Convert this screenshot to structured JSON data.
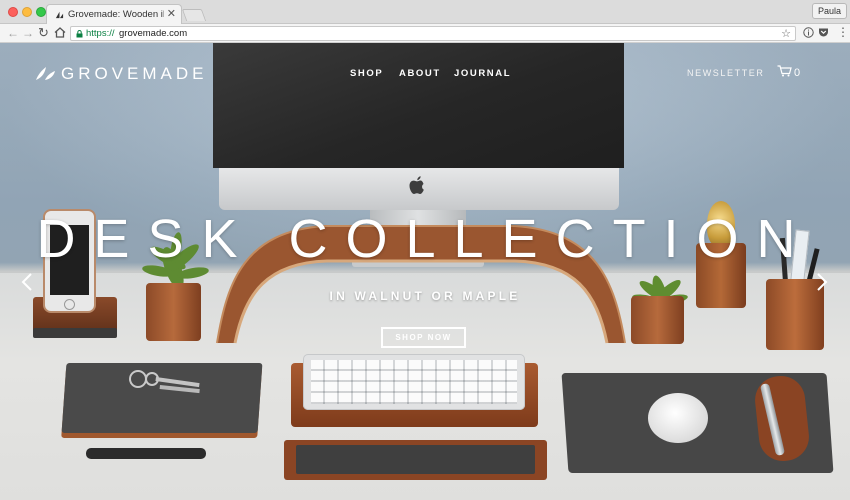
{
  "browser": {
    "tab": {
      "title": "Grovemade: Wooden iPhone C",
      "close": "✕"
    },
    "profile": "Paula",
    "url": {
      "scheme": "https://",
      "host": "grovemade.com"
    },
    "icons": {
      "back": "←",
      "forward": "→",
      "reload": "↻",
      "star": "☆",
      "menu": "⋮"
    }
  },
  "site": {
    "brand": "GROVEMADE",
    "nav": {
      "shop": "SHOP",
      "about": "ABOUT",
      "journal": "JOURNAL"
    },
    "newsletter": "NEWSLETTER",
    "cart_count": "0"
  },
  "hero": {
    "title": "DESK COLLECTION",
    "subtitle": "IN WALNUT OR MAPLE",
    "cta": "SHOP NOW"
  },
  "colors": {
    "wall": "#a9bccd",
    "walnut": "#a95b31",
    "text_on_hero": "#ffffff"
  }
}
